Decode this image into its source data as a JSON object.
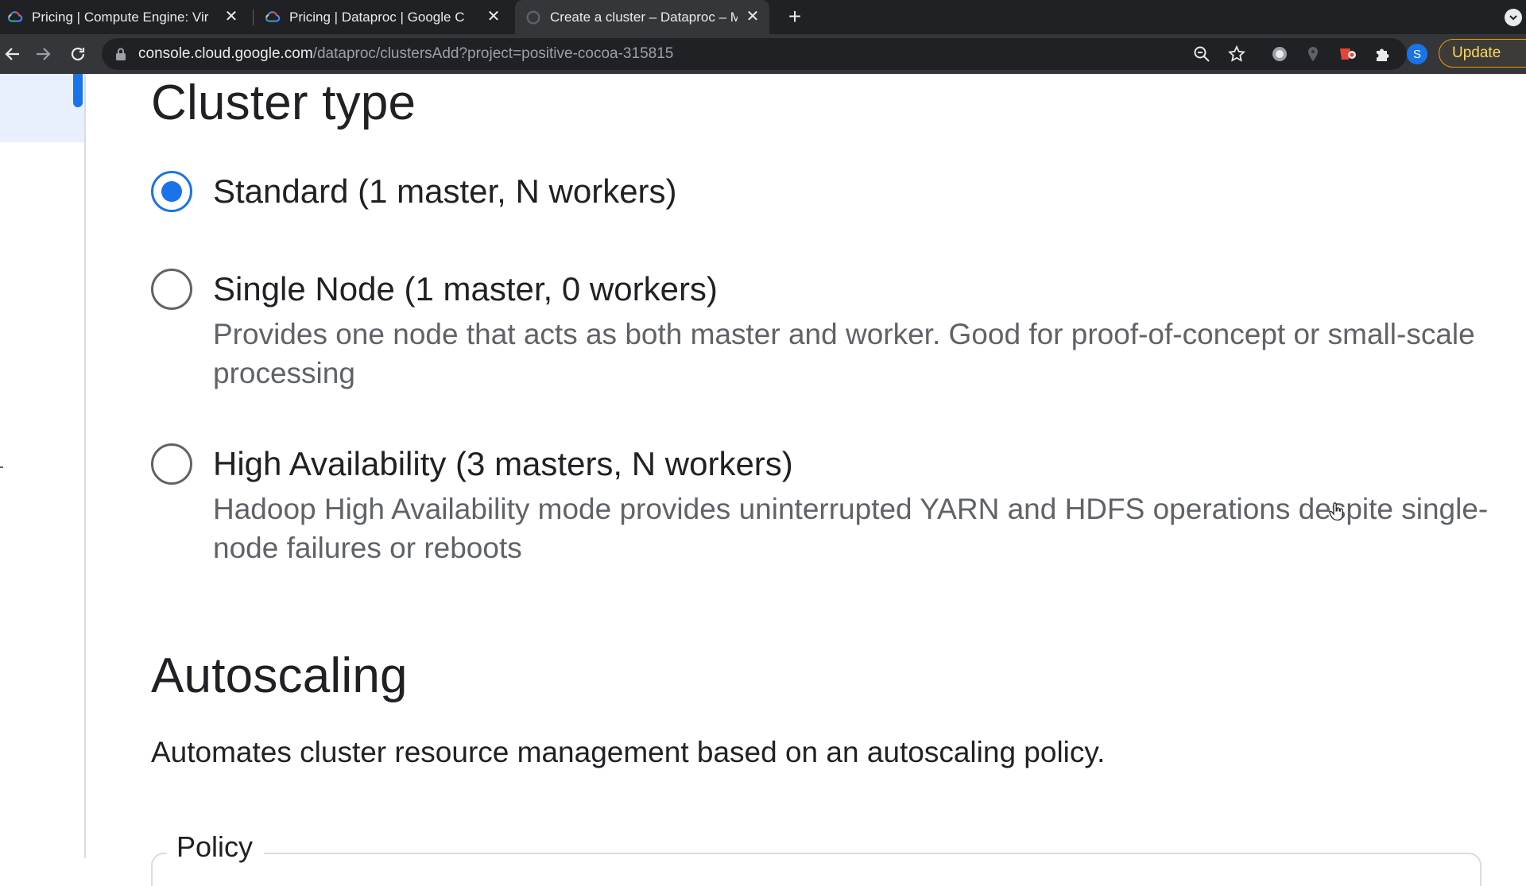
{
  "browser": {
    "tabs": [
      {
        "title": "Pricing  |  Compute Engine: Vir",
        "favicon": "google-cloud-icon",
        "active": false
      },
      {
        "title": "Pricing  |  Dataproc  |  Google C",
        "favicon": "google-cloud-icon",
        "active": false
      },
      {
        "title": "Create a cluster – Dataproc – M",
        "favicon": "loading-icon",
        "active": true
      }
    ],
    "url_host": "console.cloud.google.com",
    "url_path": "/dataproc/clustersAdd?project=positive-cocoa-315815",
    "profile_initial": "S",
    "update_label": "Update"
  },
  "cluster_type": {
    "heading": "Cluster type",
    "options": [
      {
        "label": "Standard (1 master, N workers)",
        "description": "",
        "selected": true
      },
      {
        "label": "Single Node (1 master, 0 workers)",
        "description": "Provides one node that acts as both master and worker. Good for proof-of-concept or small-scale processing",
        "selected": false
      },
      {
        "label": "High Availability (3 masters, N workers)",
        "description": "Hadoop High Availability mode provides uninterrupted YARN and HDFS operations despite single-node failures or reboots",
        "selected": false
      }
    ]
  },
  "autoscaling": {
    "heading": "Autoscaling",
    "description": "Automates cluster resource management based on an autoscaling policy.",
    "policy_label": "Policy"
  },
  "colors": {
    "accent": "#1a73e8",
    "tabstrip": "#202124",
    "toolbar": "#35363a",
    "update_border": "#f29900"
  }
}
